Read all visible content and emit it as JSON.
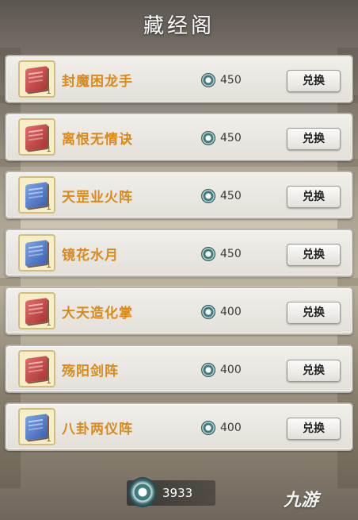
{
  "header": {
    "title": "藏经阁"
  },
  "items": [
    {
      "name": "封魔困龙手",
      "book_color": "red",
      "quantity": "1",
      "cost": "450",
      "button_label": "兑换"
    },
    {
      "name": "离恨无情诀",
      "book_color": "red",
      "quantity": "1",
      "cost": "450",
      "button_label": "兑换"
    },
    {
      "name": "天罡业火阵",
      "book_color": "blue",
      "quantity": "1",
      "cost": "450",
      "button_label": "兑换"
    },
    {
      "name": "镜花水月",
      "book_color": "blue",
      "quantity": "1",
      "cost": "450",
      "button_label": "兑换"
    },
    {
      "name": "大天造化掌",
      "book_color": "red",
      "quantity": "1",
      "cost": "400",
      "button_label": "兑换"
    },
    {
      "name": "殇阳剑阵",
      "book_color": "red",
      "quantity": "1",
      "cost": "400",
      "button_label": "兑换"
    },
    {
      "name": "八卦两仪阵",
      "book_color": "blue",
      "quantity": "1",
      "cost": "400",
      "button_label": "兑换"
    }
  ],
  "footer": {
    "currency_icon": "spirit-coin-icon",
    "balance": "3933"
  },
  "watermark": {
    "text": "九游"
  },
  "colors": {
    "item_name": "#d98a1c",
    "red_book": "#c94a4a",
    "blue_book": "#4f78c8"
  }
}
